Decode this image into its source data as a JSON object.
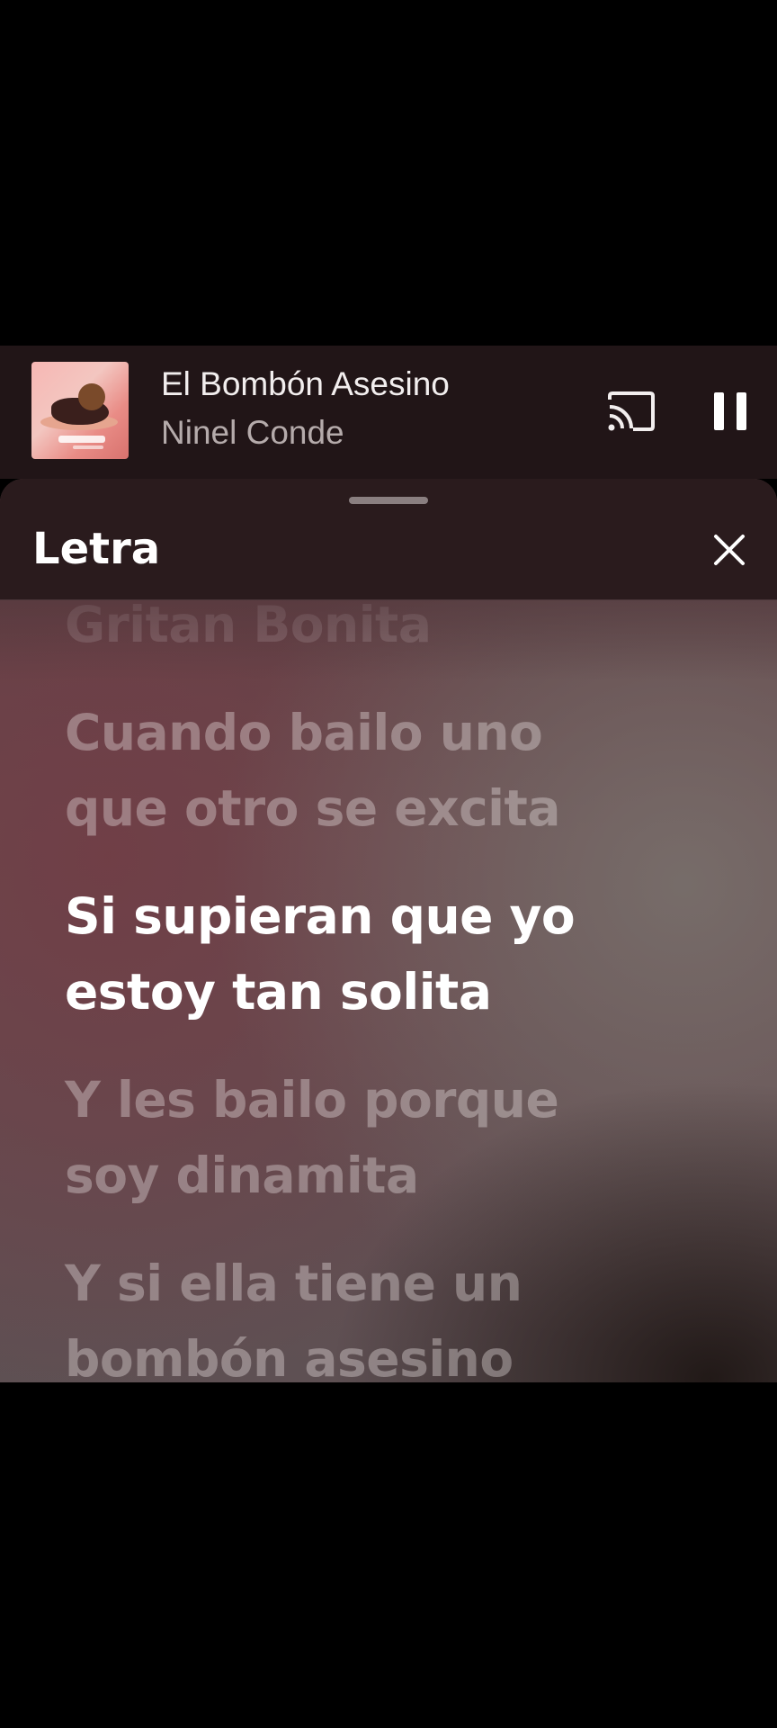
{
  "mini_player": {
    "song_title": "El Bombón Asesino",
    "artist": "Ninel Conde",
    "cover_icon": "album-cover-art",
    "cast_icon": "cast-icon",
    "pause_icon": "pause-icon"
  },
  "lyrics_sheet": {
    "title": "Letra",
    "close_icon": "close-icon",
    "lines": [
      "Gritan Bonita",
      "Cuando bailo uno",
      "que otro se excita",
      "Si supieran que yo",
      "estoy tan solita",
      "Y les bailo porque",
      "soy dinamita",
      "Y si ella tiene un",
      "bombón asesino"
    ],
    "active_lines": [
      "Si supieran que yo",
      "estoy tan solita"
    ]
  },
  "colors": {
    "background": "#000000",
    "player_bar": "#211517",
    "sheet_header": "#2a1b1d",
    "active_lyric": "#ffffff",
    "inactive_lyric": "rgba(235,225,226,0.38)"
  }
}
